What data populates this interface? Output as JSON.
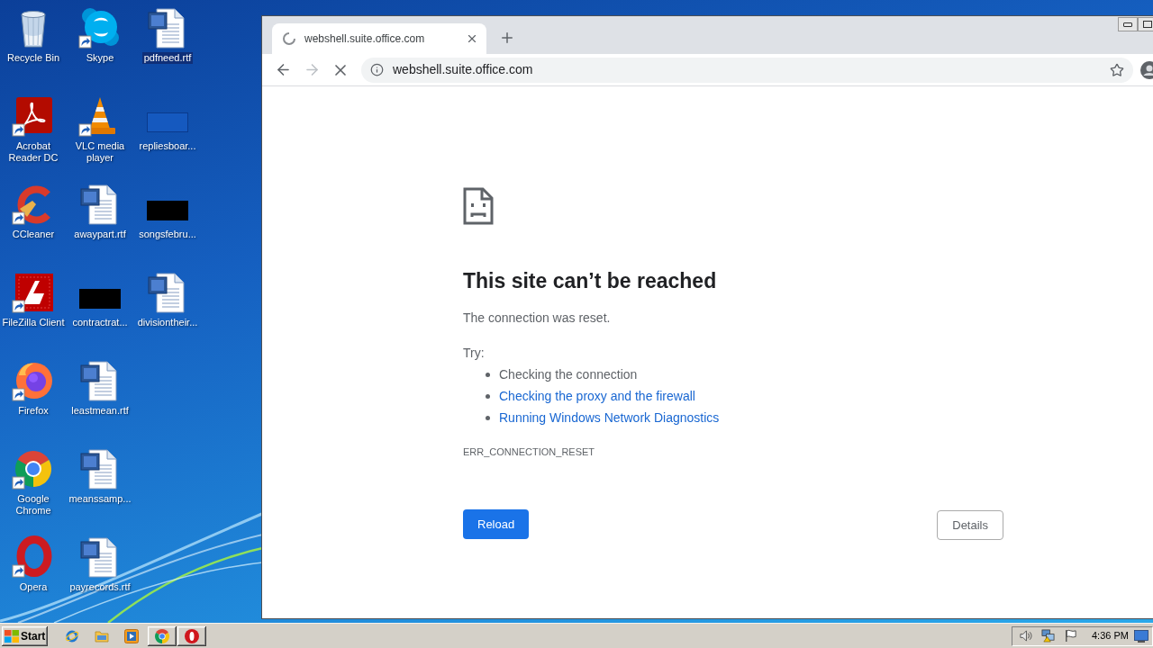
{
  "desktop": {
    "icons": [
      {
        "label": "Recycle Bin",
        "kind": "recycle",
        "shortcut": false,
        "selected": false
      },
      {
        "label": "Acrobat Reader DC",
        "kind": "acrobat",
        "shortcut": true,
        "selected": false
      },
      {
        "label": "CCleaner",
        "kind": "ccleaner",
        "shortcut": true,
        "selected": false
      },
      {
        "label": "FileZilla Client",
        "kind": "filezilla",
        "shortcut": true,
        "selected": false
      },
      {
        "label": "Firefox",
        "kind": "firefox",
        "shortcut": true,
        "selected": false
      },
      {
        "label": "Google Chrome",
        "kind": "chrome",
        "shortcut": true,
        "selected": false
      },
      {
        "label": "Opera",
        "kind": "opera",
        "shortcut": true,
        "selected": false
      },
      {
        "label": "Skype",
        "kind": "skype",
        "shortcut": true,
        "selected": false
      },
      {
        "label": "VLC media player",
        "kind": "vlc",
        "shortcut": true,
        "selected": false
      },
      {
        "label": "awaypart.rtf",
        "kind": "document",
        "shortcut": false,
        "selected": false
      },
      {
        "label": "contractrat...",
        "kind": "blackimage",
        "shortcut": false,
        "selected": false
      },
      {
        "label": "leastmean.rtf",
        "kind": "document",
        "shortcut": false,
        "selected": false
      },
      {
        "label": "meanssamp...",
        "kind": "document",
        "shortcut": false,
        "selected": false
      },
      {
        "label": "payrecords.rtf",
        "kind": "document",
        "shortcut": false,
        "selected": false
      },
      {
        "label": "pdfneed.rtf",
        "kind": "document",
        "shortcut": false,
        "selected": true
      },
      {
        "label": "repliesboar...",
        "kind": "blueimage",
        "shortcut": false,
        "selected": false
      },
      {
        "label": "songsfebru...",
        "kind": "blackimage",
        "shortcut": false,
        "selected": false
      },
      {
        "label": "divisiontheir...",
        "kind": "document",
        "shortcut": false,
        "selected": false
      }
    ]
  },
  "browser": {
    "tab": {
      "title": "webshell.suite.office.com",
      "loading": true
    },
    "toolbar": {
      "back_disabled": false,
      "forward_disabled": true
    },
    "address_bar": {
      "url": "webshell.suite.office.com"
    }
  },
  "error_page": {
    "title": "This site can’t be reached",
    "message": "The connection was reset.",
    "try_label": "Try:",
    "suggestions": [
      {
        "text": "Checking the connection",
        "link": false
      },
      {
        "text": "Checking the proxy and the firewall",
        "link": true
      },
      {
        "text": "Running Windows Network Diagnostics",
        "link": true
      }
    ],
    "error_code": "ERR_CONNECTION_RESET",
    "buttons": [
      {
        "label": "Reload",
        "primary": true
      },
      {
        "label": "Details",
        "primary": false
      }
    ]
  },
  "taskbar": {
    "start": "Start",
    "clock": "4:36 PM"
  }
}
